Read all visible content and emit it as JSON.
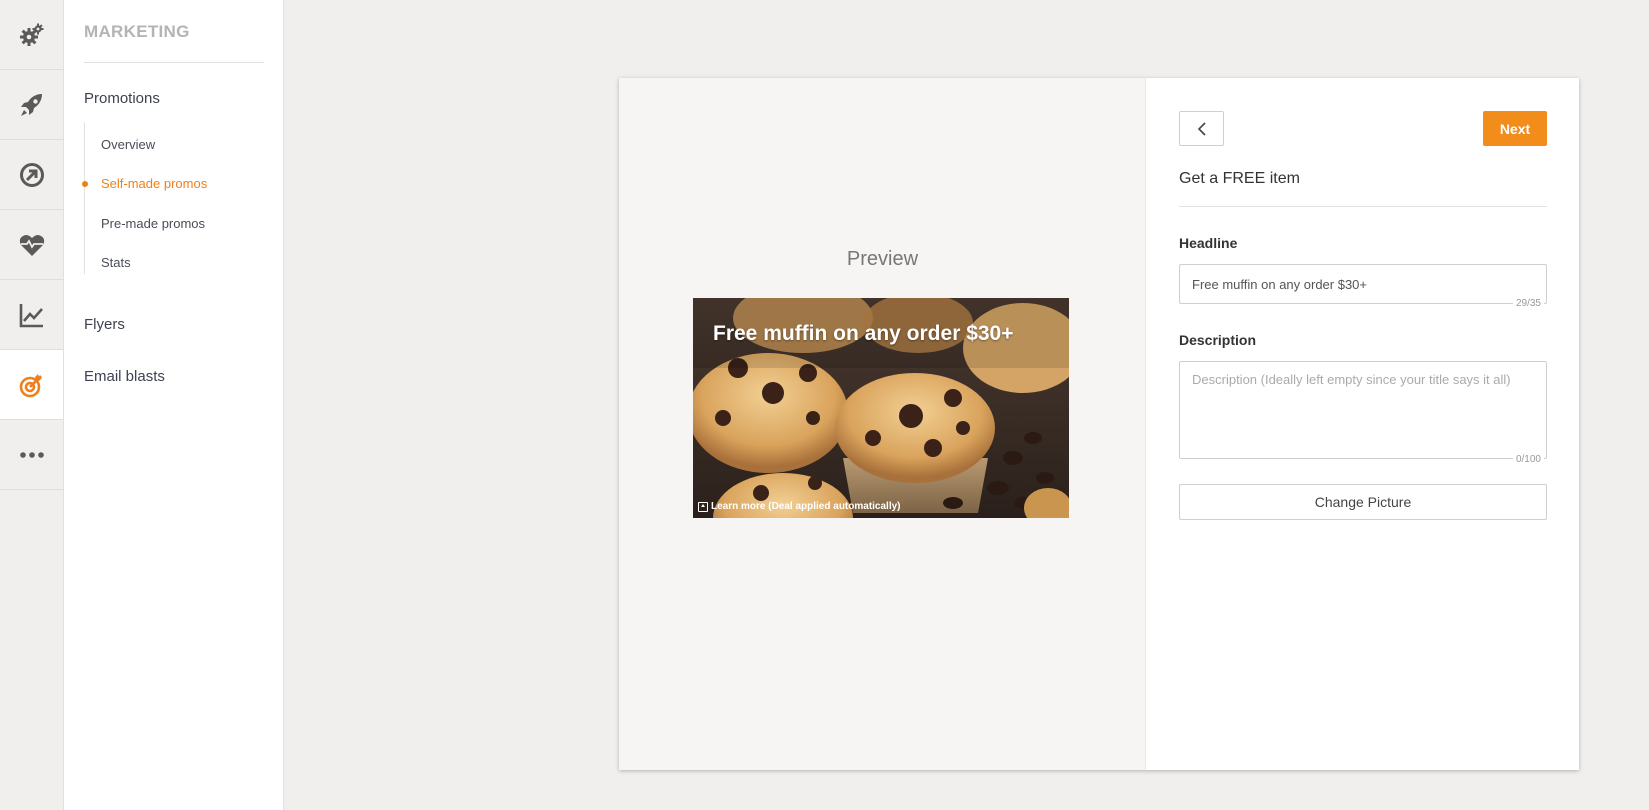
{
  "rail": {
    "items": [
      {
        "icon": "gears-icon"
      },
      {
        "icon": "rocket-icon"
      },
      {
        "icon": "compass-arrow-icon"
      },
      {
        "icon": "heart-pulse-icon"
      },
      {
        "icon": "line-chart-icon"
      },
      {
        "icon": "target-icon",
        "active": true
      },
      {
        "icon": "more-icon"
      }
    ],
    "accent_color": "#ef7f1a",
    "icon_color": "#5a5a5a"
  },
  "sidebar": {
    "section_title": "MARKETING",
    "promotions_label": "Promotions",
    "promotions_items": [
      {
        "label": "Overview"
      },
      {
        "label": "Self-made promos",
        "active": true
      },
      {
        "label": "Pre-made promos"
      },
      {
        "label": "Stats"
      }
    ],
    "flyers_label": "Flyers",
    "email_blasts_label": "Email blasts"
  },
  "preview": {
    "label": "Preview",
    "headline": "Free muffin on any order $30+",
    "learn_more": "Learn more (Deal applied automatically)"
  },
  "form": {
    "title": "Get a FREE item",
    "next_label": "Next",
    "headline_label": "Headline",
    "headline_value": "Free muffin on any order $30+",
    "headline_counter": "29/35",
    "description_label": "Description",
    "description_placeholder": "Description (Ideally left empty since your title says it all)",
    "description_counter": "0/100",
    "change_picture_label": "Change Picture"
  },
  "colors": {
    "accent": "#f28c1b",
    "background": "#f0efed"
  }
}
